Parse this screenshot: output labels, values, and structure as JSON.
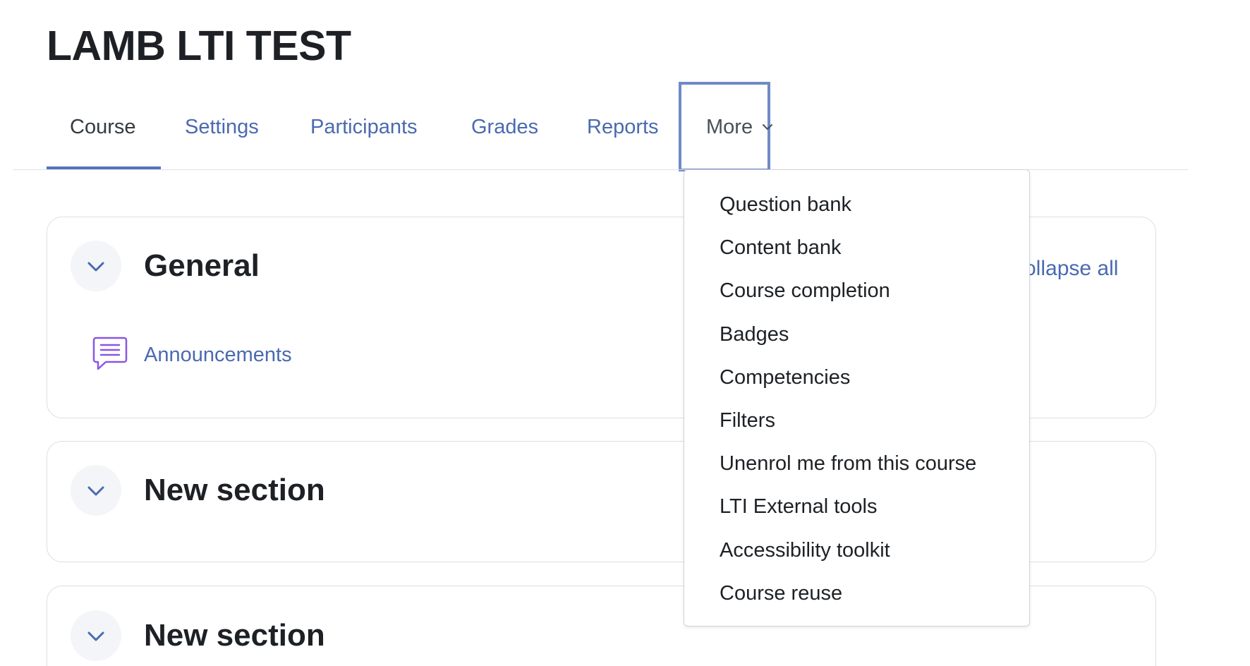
{
  "course": {
    "title": "LAMB LTI TEST"
  },
  "nav": {
    "tabs": [
      {
        "label": "Course",
        "active": true
      },
      {
        "label": "Settings"
      },
      {
        "label": "Participants"
      },
      {
        "label": "Grades"
      },
      {
        "label": "Reports"
      }
    ],
    "more_label": "More"
  },
  "content": {
    "collapse_all": "ollapse all",
    "sections": [
      {
        "title": "General",
        "activities": [
          {
            "label": "Announcements",
            "icon": "forum-icon"
          }
        ]
      },
      {
        "title": "New section"
      },
      {
        "title": "New section"
      }
    ]
  },
  "more_menu": {
    "items": [
      "Question bank",
      "Content bank",
      "Course completion",
      "Badges",
      "Competencies",
      "Filters",
      "Unenrol me from this course",
      "LTI External tools",
      "Accessibility toolkit",
      "Course reuse"
    ]
  },
  "colors": {
    "link": "#4a6ab0",
    "active_tab_underline": "#5474b9",
    "focus_outline": "#6f8ac6",
    "forum_icon": "#8a56e6",
    "text": "#1d2125"
  }
}
